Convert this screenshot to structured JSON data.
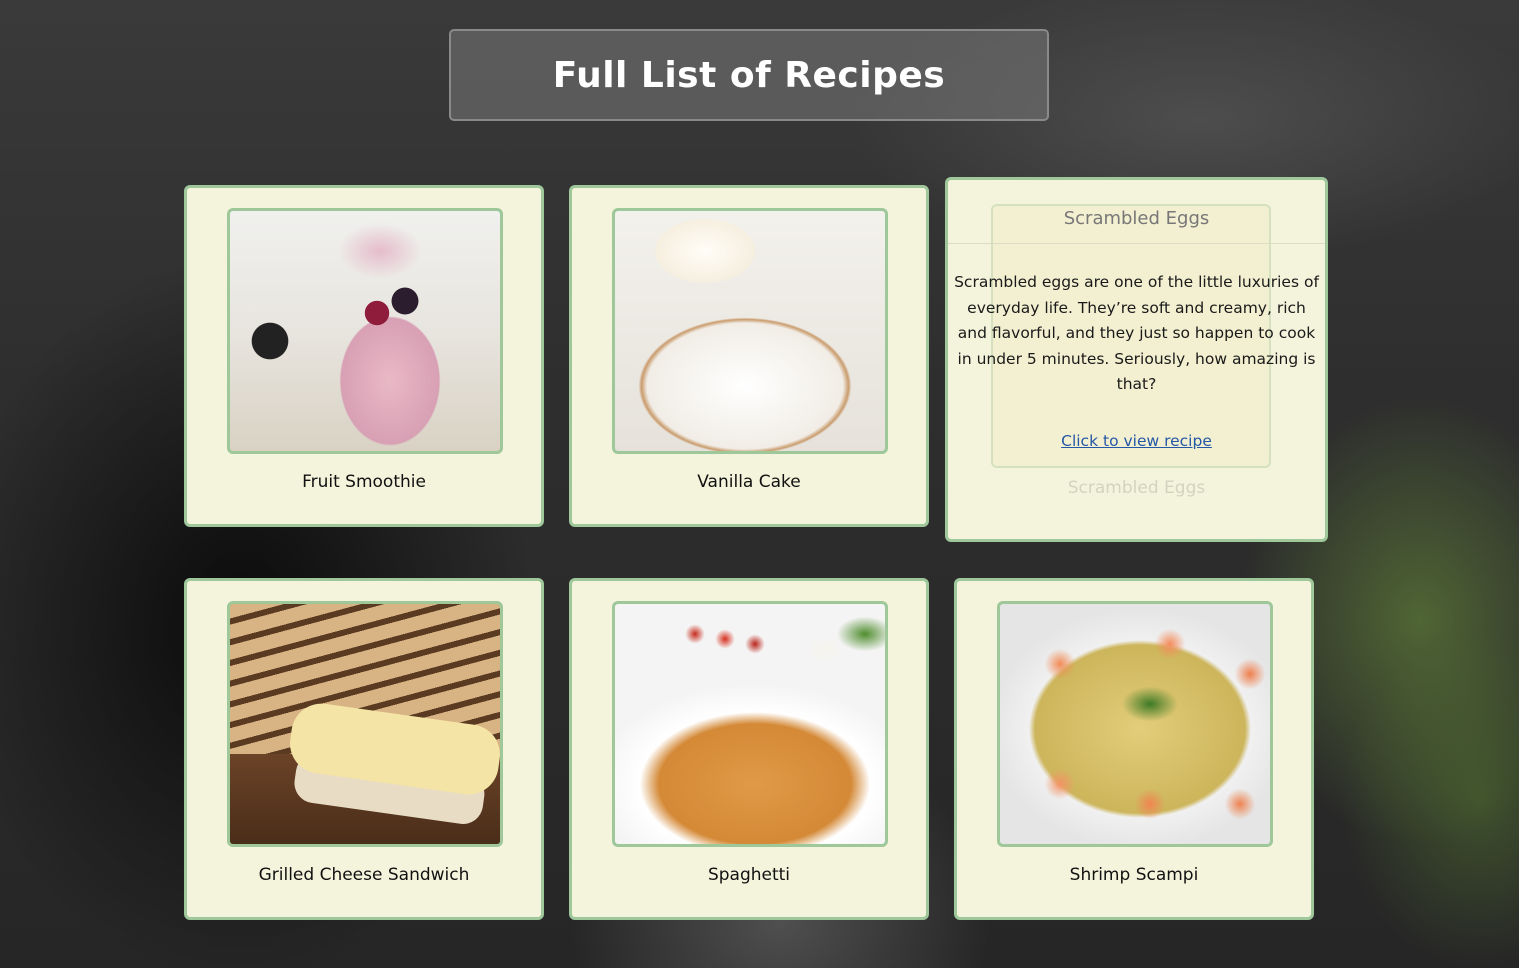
{
  "page": {
    "title": "Full List of Recipes"
  },
  "recipes": [
    {
      "name": "Fruit Smoothie",
      "image": "fruit-smoothie-photo"
    },
    {
      "name": "Vanilla Cake",
      "image": "vanilla-cake-photo"
    },
    {
      "name": "Scrambled Eggs",
      "image": "scrambled-eggs-photo",
      "description": "Scrambled eggs are one of the little luxuries of everyday life. They’re soft and creamy, rich and flavorful, and they just so happen to cook in under 5 minutes. Seriously, how amazing is that?",
      "link_label": "Click to view recipe"
    },
    {
      "name": "Grilled Cheese Sandwich",
      "image": "grilled-cheese-photo"
    },
    {
      "name": "Spaghetti",
      "image": "spaghetti-photo"
    },
    {
      "name": "Shrimp Scampi",
      "image": "shrimp-scampi-photo"
    }
  ],
  "colors": {
    "card_background": "#f4f4dc",
    "card_border": "#9ec79a",
    "link": "#2457a6",
    "title_text": "#ffffff"
  }
}
